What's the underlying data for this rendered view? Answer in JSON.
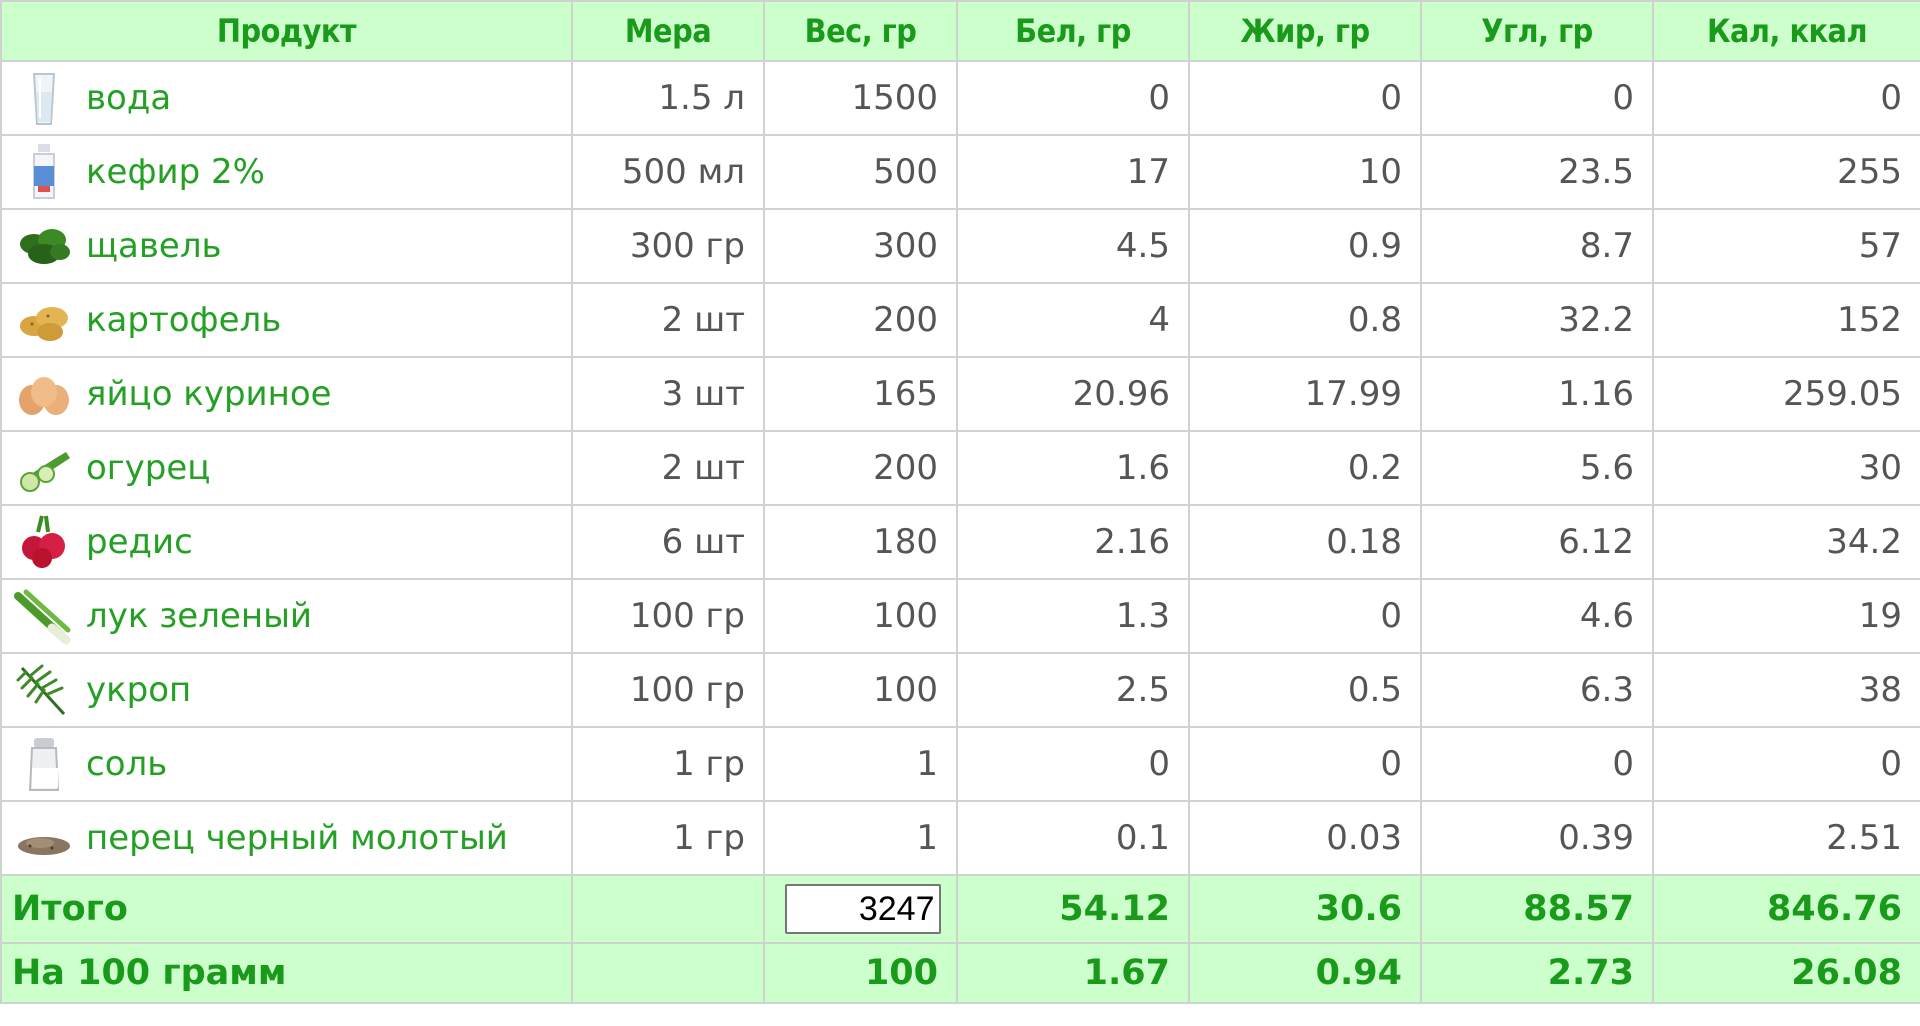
{
  "headers": {
    "product": "Продукт",
    "measure": "Мера",
    "weight": "Вес, гр",
    "protein": "Бел, гр",
    "fat": "Жир, гр",
    "carb": "Угл, гр",
    "kcal": "Кал, ккал"
  },
  "rows": [
    {
      "name": "вода",
      "icon": "water-glass-icon",
      "measure": "1.5 л",
      "weight": "1500",
      "protein": "0",
      "fat": "0",
      "carb": "0",
      "kcal": "0"
    },
    {
      "name": "кефир 2%",
      "icon": "kefir-bottle-icon",
      "measure": "500 мл",
      "weight": "500",
      "protein": "17",
      "fat": "10",
      "carb": "23.5",
      "kcal": "255"
    },
    {
      "name": "щавель",
      "icon": "sorrel-icon",
      "measure": "300 гр",
      "weight": "300",
      "protein": "4.5",
      "fat": "0.9",
      "carb": "8.7",
      "kcal": "57"
    },
    {
      "name": "картофель",
      "icon": "potato-icon",
      "measure": "2 шт",
      "weight": "200",
      "protein": "4",
      "fat": "0.8",
      "carb": "32.2",
      "kcal": "152"
    },
    {
      "name": "яйцо куриное",
      "icon": "egg-icon",
      "measure": "3 шт",
      "weight": "165",
      "protein": "20.96",
      "fat": "17.99",
      "carb": "1.16",
      "kcal": "259.05"
    },
    {
      "name": "огурец",
      "icon": "cucumber-icon",
      "measure": "2 шт",
      "weight": "200",
      "protein": "1.6",
      "fat": "0.2",
      "carb": "5.6",
      "kcal": "30"
    },
    {
      "name": "редис",
      "icon": "radish-icon",
      "measure": "6 шт",
      "weight": "180",
      "protein": "2.16",
      "fat": "0.18",
      "carb": "6.12",
      "kcal": "34.2"
    },
    {
      "name": "лук зеленый",
      "icon": "green-onion-icon",
      "measure": "100 гр",
      "weight": "100",
      "protein": "1.3",
      "fat": "0",
      "carb": "4.6",
      "kcal": "19"
    },
    {
      "name": "укроп",
      "icon": "dill-icon",
      "measure": "100 гр",
      "weight": "100",
      "protein": "2.5",
      "fat": "0.5",
      "carb": "6.3",
      "kcal": "38"
    },
    {
      "name": "соль",
      "icon": "salt-shaker-icon",
      "measure": "1 гр",
      "weight": "1",
      "protein": "0",
      "fat": "0",
      "carb": "0",
      "kcal": "0"
    },
    {
      "name": "перец черный молотый",
      "icon": "ground-pepper-icon",
      "measure": "1 гр",
      "weight": "1",
      "protein": "0.1",
      "fat": "0.03",
      "carb": "0.39",
      "kcal": "2.51"
    }
  ],
  "total": {
    "label": "Итого",
    "measure": "",
    "weight_value": "3247",
    "protein": "54.12",
    "fat": "30.6",
    "carb": "88.57",
    "kcal": "846.76"
  },
  "per100": {
    "label": "На 100 грамм",
    "measure": "",
    "weight": "100",
    "protein": "1.67",
    "fat": "0.94",
    "carb": "2.73",
    "kcal": "26.08"
  },
  "colors": {
    "header_bg": "#ccffcc",
    "header_text": "#1a9a1a",
    "link": "#24a024",
    "value_text": "#555555",
    "border": "#cfd3cf"
  }
}
